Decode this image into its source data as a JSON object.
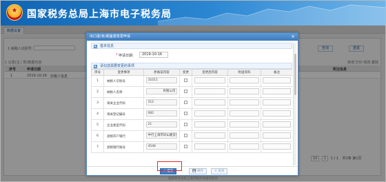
{
  "banner": {
    "title": "国家税务总局上海市电子税务局"
  },
  "page": {
    "tab_label": "数据设置",
    "search_label": "1 纳税人识别号:",
    "btn_query": "查询",
    "btn_reset": "重置",
    "row_tools": "1 记录(主 / 附)数据内容",
    "right_tools": "新增 打印 修改 删除",
    "grid_headers": [
      "序号",
      "申请日期",
      "附注信息"
    ],
    "grid_row": {
      "no": "1",
      "date": "2019-10-16",
      "type": "办税人信息"
    },
    "pager": {
      "page_size": "10",
      "first": "1",
      "page_info": "1 / 1",
      "summary": "共1条 第1页"
    },
    "footer": "国家税务总局上海市税务局版权所有"
  },
  "modal": {
    "title": "出口退(免)税备案变更申请",
    "section_basic": "基本信息",
    "date_label": "申请日期:",
    "date_value": "2019-10-16",
    "section_items": "请勾选需要变更的事项",
    "columns": [
      "序号",
      "变更事项",
      "原备案内容",
      "变更",
      "变更后内容",
      "附送资料",
      "备注"
    ],
    "rows": [
      {
        "no": "1",
        "item": "纳税人识别号",
        "original": "31011"
      },
      {
        "no": "2",
        "item": "纳税人名称",
        "original": "有限公司"
      },
      {
        "no": "3",
        "item": "海关企业代码",
        "original": "312"
      },
      {
        "no": "4",
        "item": "海关登记编号",
        "original": "082"
      },
      {
        "no": "5",
        "item": "企业类型代码",
        "original": "21"
      },
      {
        "no": "6",
        "item": "退税开户银行",
        "original": "中行上海市同山路支行"
      },
      {
        "no": "7",
        "item": "退税银行账号",
        "original": "4546"
      }
    ],
    "buttons": {
      "submit": "提交",
      "save": "保存",
      "close": "关闭"
    }
  },
  "colors": {
    "header_blue": "#1a6fbf",
    "highlight_red": "#e0242a",
    "primary_button": "#3e7fc4"
  }
}
